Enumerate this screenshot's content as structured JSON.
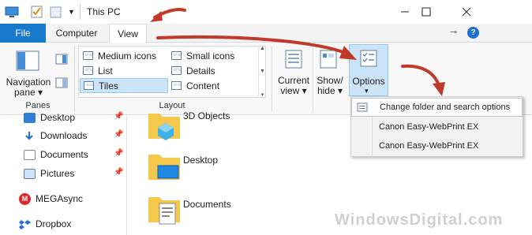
{
  "window": {
    "title": "This PC"
  },
  "tabs": {
    "file": "File",
    "computer": "Computer",
    "view": "View"
  },
  "help_glyph": "?",
  "ribbon": {
    "panes": {
      "nav_pane_label_1": "Navigation",
      "nav_pane_label_2": "pane",
      "group_label": "Panes"
    },
    "layout": {
      "group_label": "Layout",
      "items_left": [
        "Medium icons",
        "List",
        "Tiles"
      ],
      "items_right": [
        "Small icons",
        "Details",
        "Content"
      ],
      "selected": "Tiles"
    },
    "current_view": {
      "line1": "Current",
      "line2": "view"
    },
    "show_hide": {
      "line1": "Show/",
      "line2": "hide"
    },
    "options": {
      "label": "Options"
    }
  },
  "dropdown": {
    "items": [
      "Change folder and search options",
      "Canon Easy-WebPrint EX",
      "Canon Easy-WebPrint EX"
    ]
  },
  "nav": {
    "items": [
      "Desktop",
      "Downloads",
      "Documents",
      "Pictures",
      "MEGAsync",
      "Dropbox"
    ]
  },
  "content": {
    "items": [
      "3D Objects",
      "Desktop",
      "Documents"
    ]
  },
  "watermark": "WindowsDigital.com",
  "colors": {
    "accent": "#1979ca",
    "selection": "#cce4f7",
    "arrow": "#c0392b"
  }
}
